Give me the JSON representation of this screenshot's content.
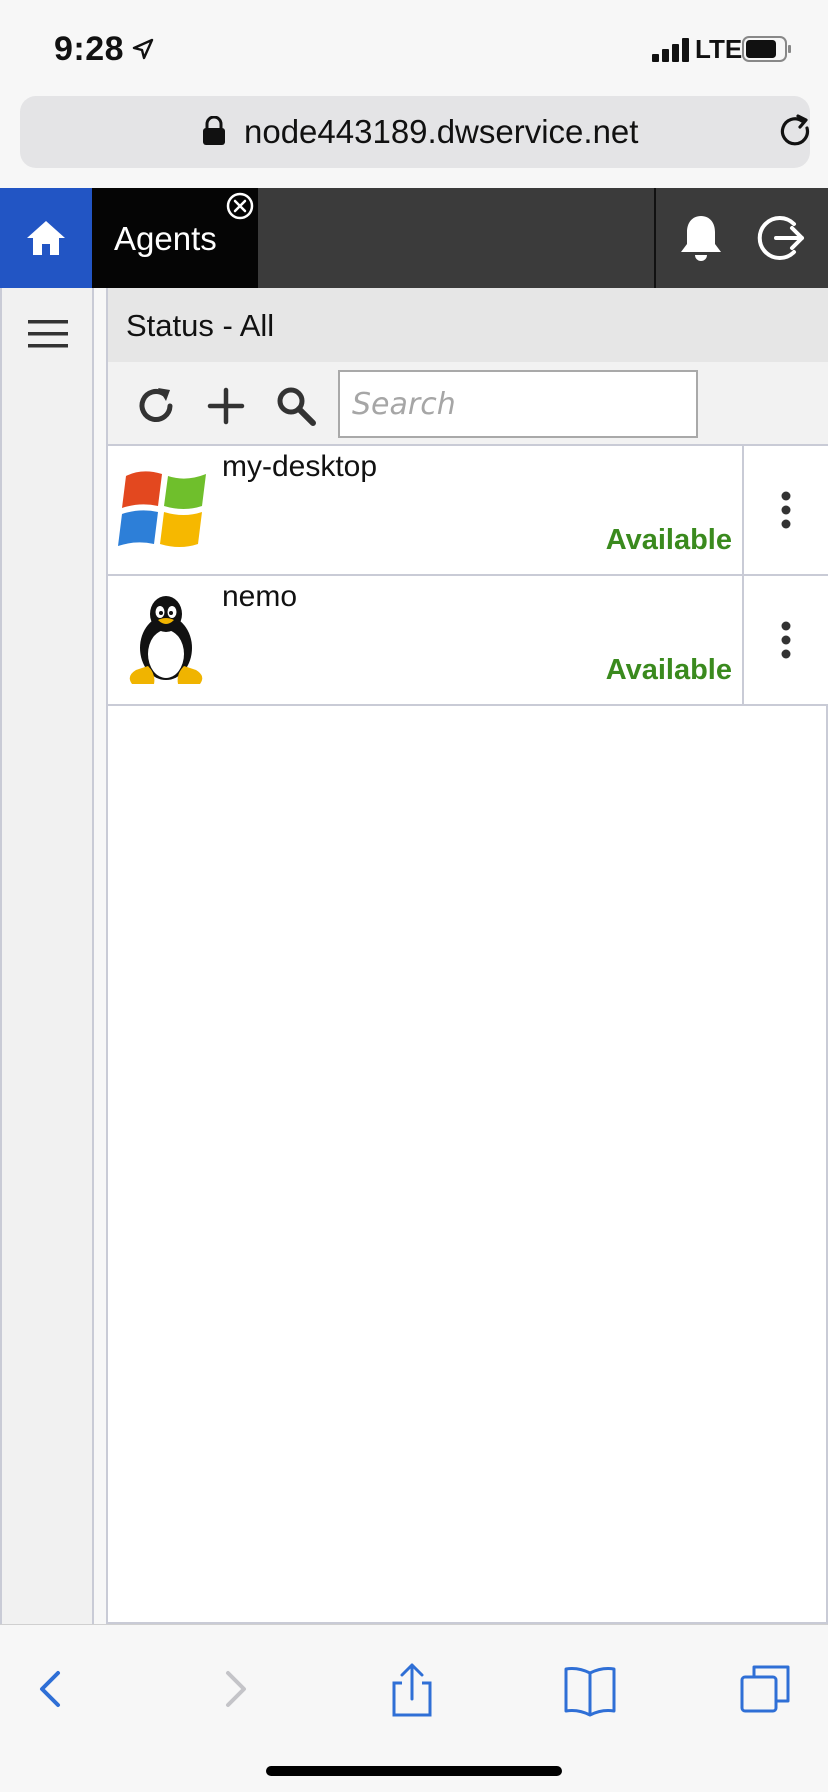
{
  "status_bar": {
    "time": "9:28",
    "network": "LTE"
  },
  "browser": {
    "url": "node443189.dwservice.net"
  },
  "header": {
    "tab_label": "Agents",
    "accent_color": "#2255c4"
  },
  "panel": {
    "title": "Status - All",
    "search_placeholder": "Search"
  },
  "agents": [
    {
      "name": "my-desktop",
      "status": "Available",
      "os_icon": "windows-logo-icon"
    },
    {
      "name": "nemo",
      "status": "Available",
      "os_icon": "linux-tux-icon"
    }
  ],
  "colors": {
    "status_available": "#3a8a1e",
    "header_bg": "#3b3b3b",
    "ios_blue": "#2f6fd6"
  }
}
